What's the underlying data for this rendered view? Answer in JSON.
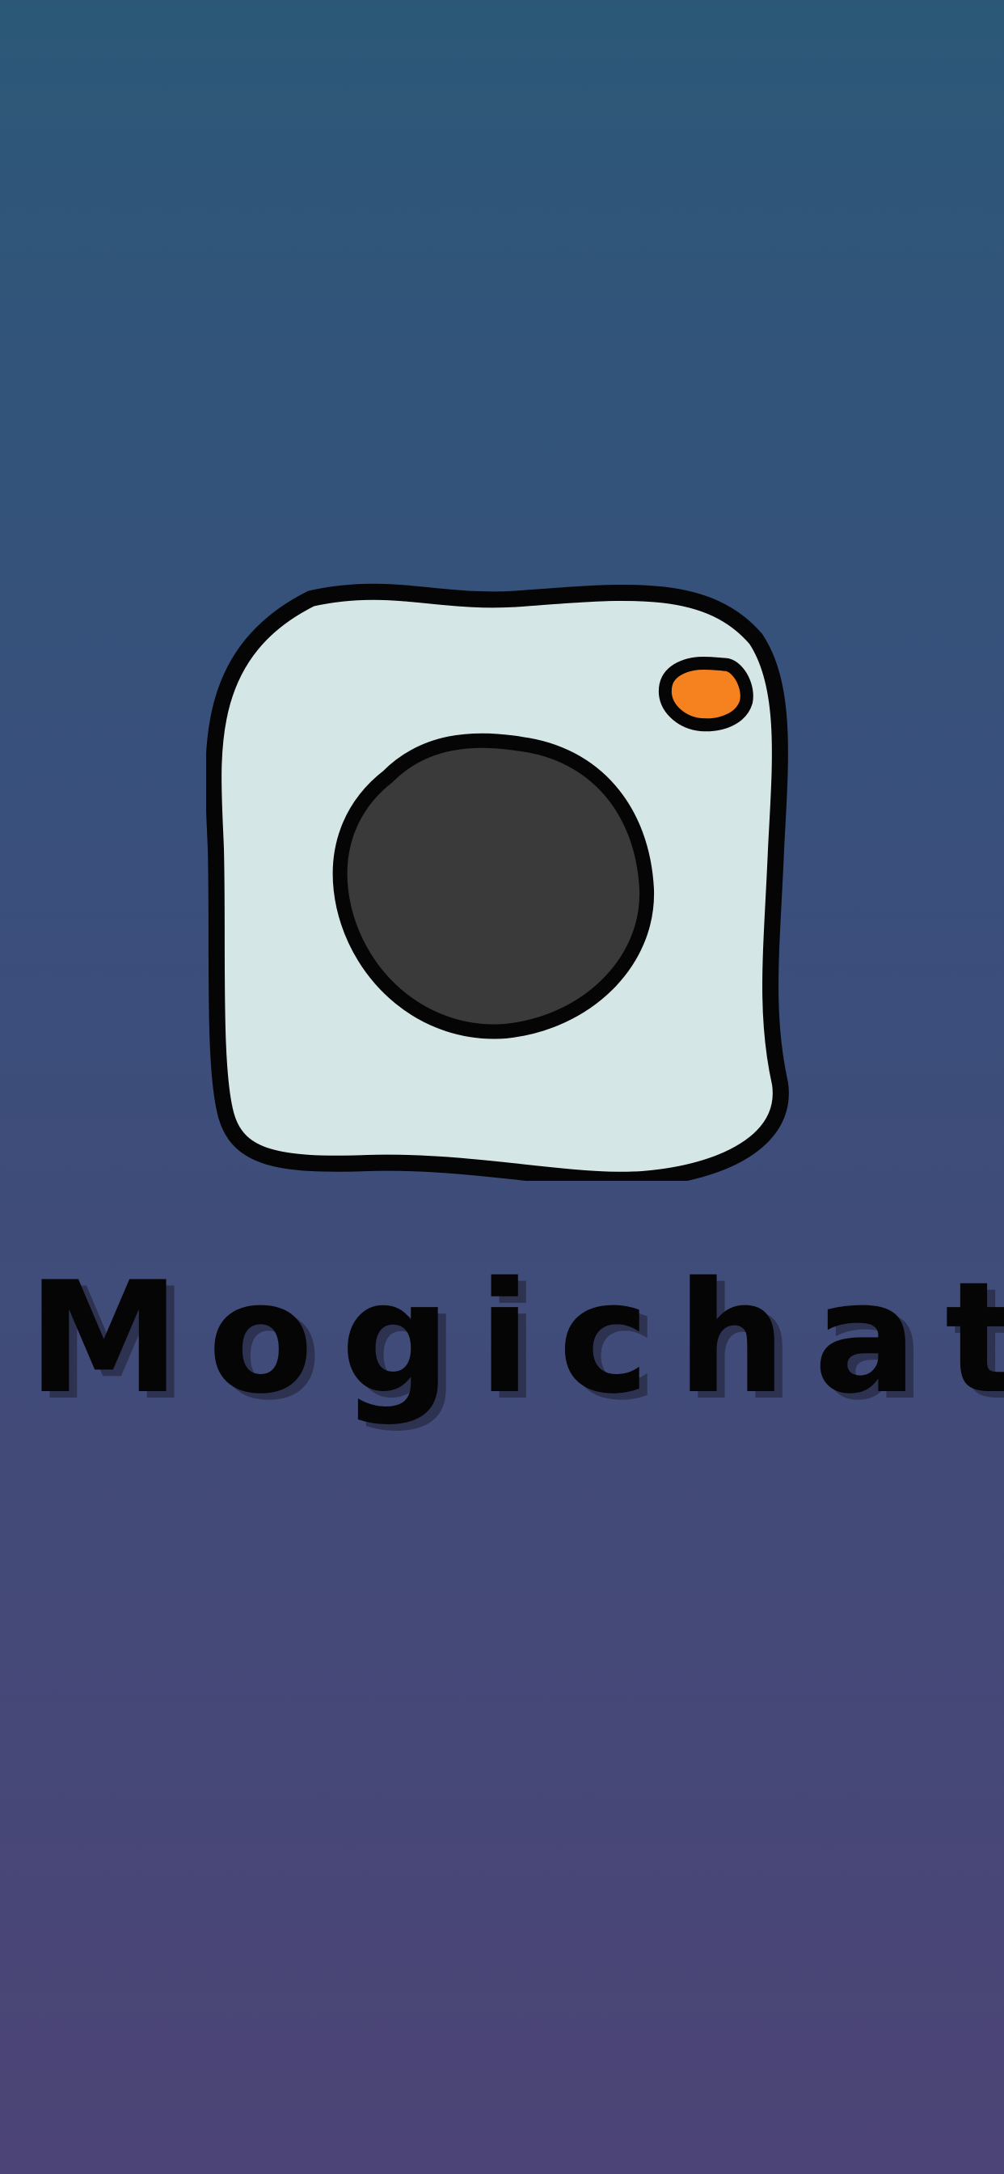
{
  "app": {
    "name": "Mogichat"
  },
  "logo": {
    "icon": "camera-icon"
  },
  "colors": {
    "background_top": "#2c5878",
    "background_bottom": "#4c4476",
    "camera_body": "#d5e6e6",
    "camera_lens": "#3a3a3a",
    "camera_flash": "#f5821f",
    "outline": "#050505"
  }
}
